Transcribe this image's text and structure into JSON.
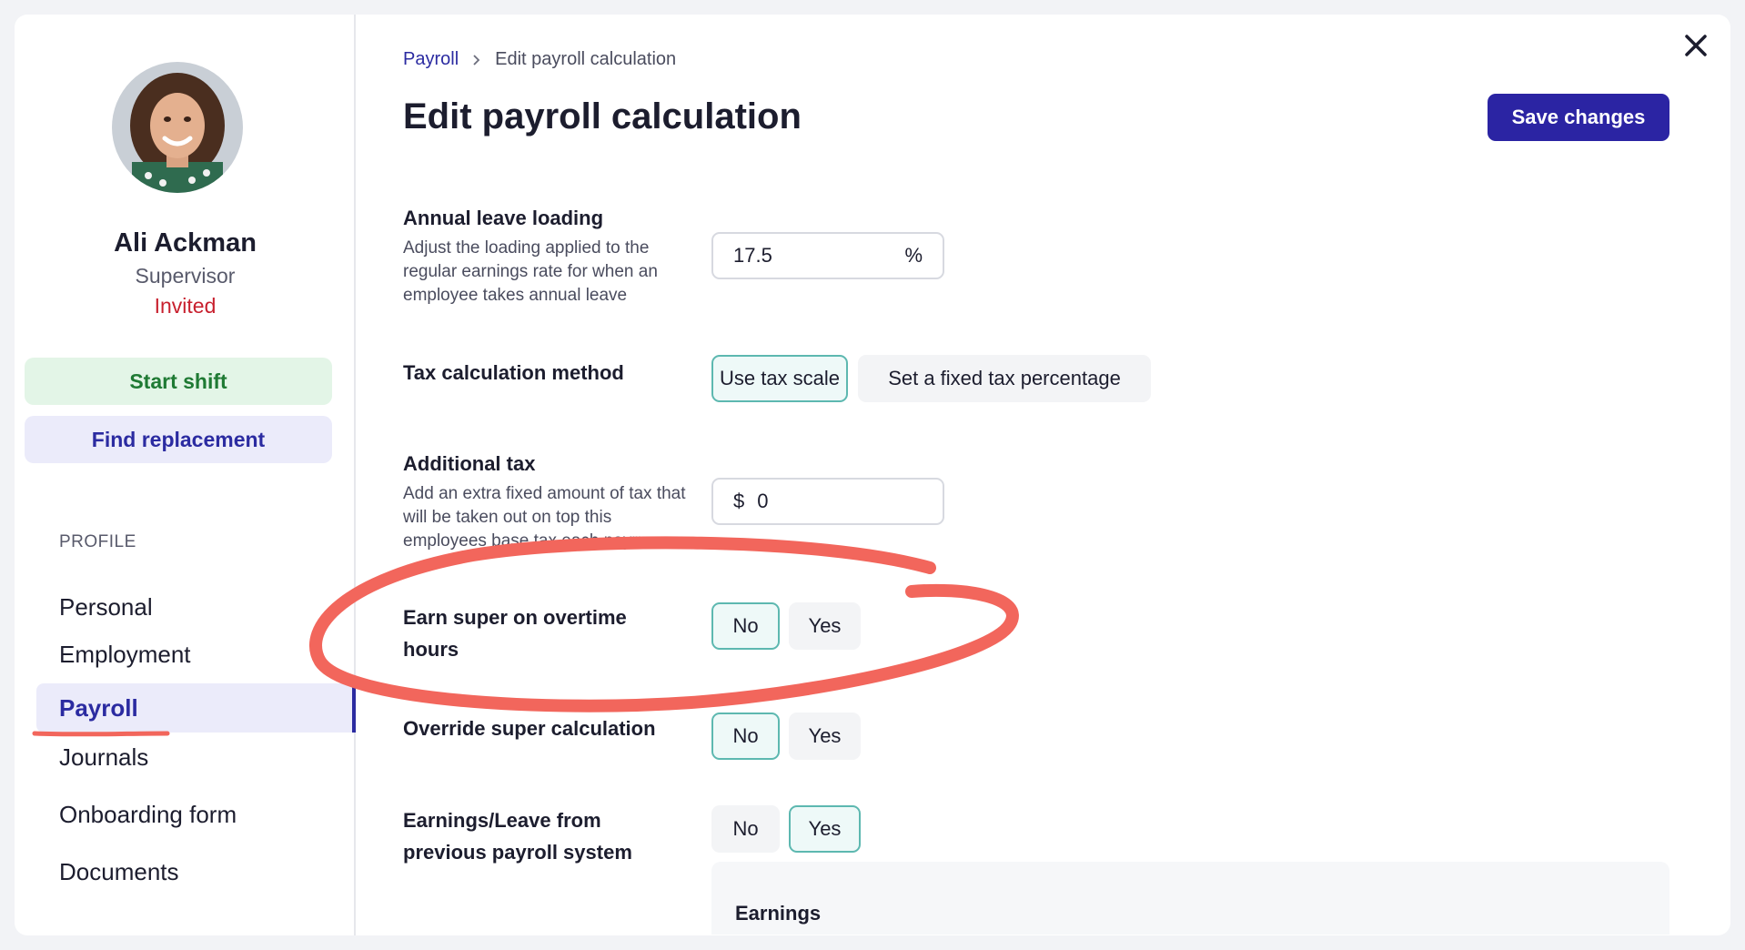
{
  "profile": {
    "name": "Ali Ackman",
    "role": "Supervisor",
    "status": "Invited",
    "status_color": "#c8202e"
  },
  "actions": {
    "start_shift": "Start shift",
    "find_replacement": "Find replacement"
  },
  "sidebar": {
    "section_label": "PROFILE",
    "items": [
      {
        "label": "Personal",
        "active": false
      },
      {
        "label": "Employment",
        "active": false
      },
      {
        "label": "Payroll",
        "active": true
      },
      {
        "label": "Journals",
        "active": false
      },
      {
        "label": "Onboarding form",
        "active": false
      },
      {
        "label": "Documents",
        "active": false
      }
    ]
  },
  "breadcrumb": {
    "parent": "Payroll",
    "current": "Edit payroll calculation"
  },
  "page": {
    "title": "Edit payroll calculation",
    "save_label": "Save changes"
  },
  "fields": {
    "annual_leave": {
      "label": "Annual leave loading",
      "description": "Adjust the loading applied to the regular earnings rate for when an employee takes annual leave",
      "value": "17.5",
      "suffix": "%"
    },
    "tax_method": {
      "label": "Tax calculation method",
      "options": [
        "Use tax scale",
        "Set a fixed tax percentage"
      ],
      "selected": "Use tax scale"
    },
    "additional_tax": {
      "label": "Additional tax",
      "description": "Add an extra fixed amount of tax that will be taken out on top this employees base tax each payrun",
      "prefix": "$",
      "value": "0"
    },
    "super_overtime": {
      "label": "Earn super on overtime hours",
      "options": [
        "No",
        "Yes"
      ],
      "selected": "No"
    },
    "override_super": {
      "label": "Override super calculation",
      "options": [
        "No",
        "Yes"
      ],
      "selected": "No"
    },
    "previous_system": {
      "label": "Earnings/Leave from previous payroll system",
      "options": [
        "No",
        "Yes"
      ],
      "selected": "Yes"
    }
  },
  "earnings": {
    "title": "Earnings"
  },
  "colors": {
    "brand": "#2b24a3",
    "selected_border": "#5db8b0",
    "annotation": "#f2665c"
  },
  "icons": [
    "close-icon",
    "chevron-right-icon"
  ]
}
